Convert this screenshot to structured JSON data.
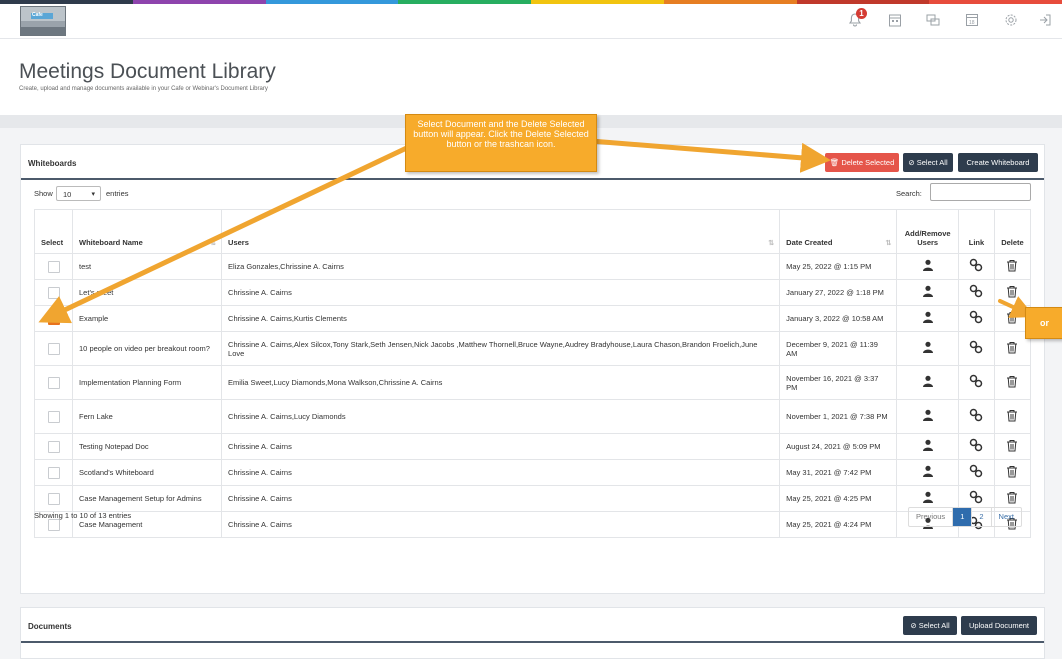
{
  "header": {
    "logo_label": "Cafe",
    "notification_count": "1",
    "icons": [
      "bell-icon",
      "calendar-icon",
      "chat-icon",
      "schedule-icon",
      "gear-icon",
      "logout-icon"
    ],
    "stripe_colors": [
      "#2f3b4c",
      "#8e44ad",
      "#3498db",
      "#27ae60",
      "#f1c40f",
      "#e67e22",
      "#c0392b",
      "#e74c3c"
    ]
  },
  "page": {
    "title": "Meetings Document Library",
    "subtitle": "Create, upload and manage documents available in your Cafe or Webinar's Document Library"
  },
  "whiteboards": {
    "title": "Whiteboards",
    "delete_selected_label": "🗑 Delete Selected",
    "select_all_label": "⊘ Select All",
    "create_label": "Create Whiteboard",
    "show_label": "Show",
    "entries_value": "10",
    "entries_label": "entries",
    "search_label": "Search:",
    "columns": {
      "select": "Select",
      "name": "Whiteboard Name",
      "users": "Users",
      "date": "Date Created",
      "addremove": "Add/Remove Users",
      "link": "Link",
      "delete": "Delete"
    },
    "rows": [
      {
        "name": "test",
        "users": "Eliza Gonzales,Chrissine A. Cairns",
        "date": "May 25, 2022 @ 1:15 PM",
        "checked": false
      },
      {
        "name": "Let's meet",
        "users": "Chrissine A. Cairns",
        "date": "January 27, 2022 @ 1:18 PM",
        "checked": false
      },
      {
        "name": "Example",
        "users": "Chrissine A. Cairns,Kurtis Clements",
        "date": "January 3, 2022 @ 10:58 AM",
        "checked": true
      },
      {
        "name": "10 people on video per breakout room?",
        "users": "Chrissine A. Cairns,Alex Silcox,Tony Stark,Seth Jensen,Nick Jacobs ,Matthew Thornell,Bruce Wayne,Audrey Bradyhouse,Laura Chason,Brandon Froelich,June Love",
        "date": "December 9, 2021 @ 11:39 AM",
        "checked": false
      },
      {
        "name": "Implementation Planning Form",
        "users": "Emilia Sweet,Lucy Diamonds,Mona Walkson,Chrissine A. Cairns",
        "date": "November 16, 2021 @ 3:37 PM",
        "checked": false
      },
      {
        "name": "Fern Lake",
        "users": "Chrissine A. Cairns,Lucy Diamonds",
        "date": "November 1, 2021 @ 7:38 PM",
        "checked": false
      },
      {
        "name": "Testing Notepad Doc",
        "users": "Chrissine A. Cairns",
        "date": "August 24, 2021 @ 5:09 PM",
        "checked": false
      },
      {
        "name": "Scotland's Whiteboard",
        "users": "Chrissine A. Cairns",
        "date": "May 31, 2021 @ 7:42 PM",
        "checked": false
      },
      {
        "name": "Case Management Setup for Admins",
        "users": "Chrissine A. Cairns",
        "date": "May 25, 2021 @ 4:25 PM",
        "checked": false
      },
      {
        "name": "Case Management",
        "users": "Chrissine A. Cairns",
        "date": "May 25, 2021 @ 4:24 PM",
        "checked": false
      }
    ],
    "showing": "Showing 1 to 10 of 13 entries",
    "pager": {
      "prev": "Previous",
      "p1": "1",
      "p2": "2",
      "next": "Next"
    }
  },
  "documents": {
    "title": "Documents",
    "select_all_label": "⊘ Select All",
    "upload_label": "Upload Document"
  },
  "callouts": {
    "main": "Select Document and the Delete Selected button will appear. Click the Delete Selected button or the trashcan icon.",
    "or": "or"
  },
  "colors": {
    "accent": "#e8731d",
    "danger": "#e5554a",
    "dark": "#2e3c4d",
    "callout": "#f7ab2b"
  }
}
